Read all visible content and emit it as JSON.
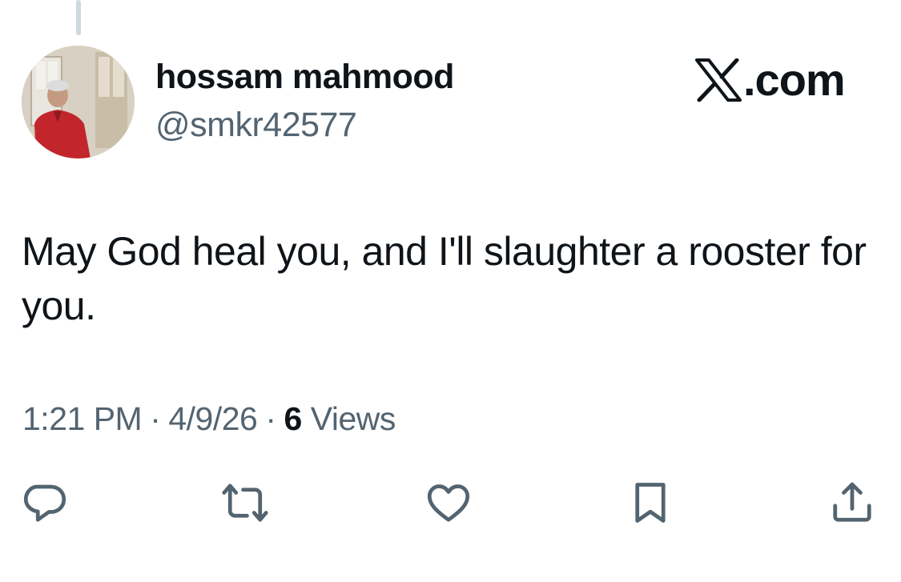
{
  "tweet": {
    "author": {
      "display_name": "hossam mahmood",
      "handle": "@smkr42577",
      "avatar": "profile-photo"
    },
    "brand": {
      "logo_icon": "x-logo-icon",
      "text": ".com"
    },
    "text": "May God heal you, and I'll slaughter a rooster for you.",
    "meta": {
      "time": "1:21 PM",
      "separator": "·",
      "date": "4/9/26",
      "views_count": "6",
      "views_label": "Views"
    },
    "actions": [
      {
        "name": "reply",
        "icon": "speech-bubble-icon"
      },
      {
        "name": "repost",
        "icon": "repost-arrows-icon"
      },
      {
        "name": "like",
        "icon": "heart-icon"
      },
      {
        "name": "bookmark",
        "icon": "bookmark-icon"
      },
      {
        "name": "share",
        "icon": "share-upload-icon"
      }
    ]
  },
  "colors": {
    "text_primary": "#0f1419",
    "text_secondary": "#536471",
    "thread_line": "#cfd9de",
    "background": "#ffffff"
  }
}
